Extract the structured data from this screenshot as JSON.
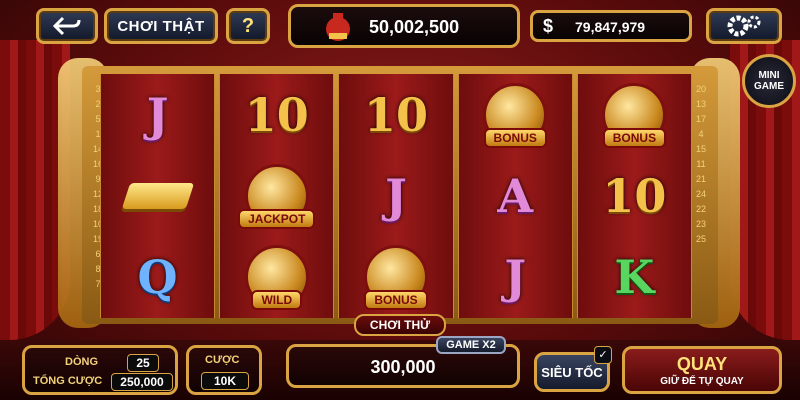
{
  "top": {
    "back_icon": "arrow-back-icon",
    "play_real_label": "CHƠI THẬT",
    "help_label": "?",
    "jackpot_value": "50,002,500",
    "balance_currency": "$",
    "balance_value": "79,847,979",
    "settings_icon": "gear-icon"
  },
  "mini_game": {
    "line1": "MINI",
    "line2": "GAME"
  },
  "line_numbers": {
    "left": [
      "3",
      "2",
      "5",
      "1",
      "14",
      "16",
      "9",
      "12",
      "18",
      "10",
      "19",
      "6",
      "8",
      "7"
    ],
    "right": [
      "20",
      "13",
      "17",
      "4",
      "15",
      "11",
      "21",
      "24",
      "22",
      "23",
      "25"
    ]
  },
  "reels": [
    [
      {
        "kind": "letter",
        "value": "J",
        "color": "pink"
      },
      {
        "kind": "gold",
        "value": ""
      },
      {
        "kind": "letter",
        "value": "Q",
        "color": "blue"
      }
    ],
    [
      {
        "kind": "letter",
        "value": "10",
        "color": "gold"
      },
      {
        "kind": "badge",
        "value": "JACKPOT"
      },
      {
        "kind": "badge",
        "value": "WILD"
      }
    ],
    [
      {
        "kind": "letter",
        "value": "10",
        "color": "gold"
      },
      {
        "kind": "letter",
        "value": "J",
        "color": "pink"
      },
      {
        "kind": "badge",
        "value": "BONUS"
      }
    ],
    [
      {
        "kind": "badge",
        "value": "BONUS"
      },
      {
        "kind": "letter",
        "value": "A",
        "color": "pink"
      },
      {
        "kind": "letter",
        "value": "J",
        "color": "pink"
      }
    ],
    [
      {
        "kind": "badge",
        "value": "BONUS"
      },
      {
        "kind": "letter",
        "value": "10",
        "color": "gold"
      },
      {
        "kind": "letter",
        "value": "K",
        "color": "green"
      }
    ]
  ],
  "try_label": "CHƠI THỬ",
  "bottom": {
    "lines_label": "DÒNG",
    "lines_value": "25",
    "total_bet_label": "TỔNG CƯỢC",
    "total_bet_value": "250,000",
    "bet_label": "CƯỢC",
    "bet_value": "10K",
    "win_value": "300,000",
    "game_x2_label": "GAME X2",
    "turbo_label": "SIÊU TỐC",
    "turbo_check": "✓",
    "spin_label": "QUAY",
    "auto_spin_label": "GIỮ ĐỂ TỰ QUAY"
  },
  "colors": {
    "gold": "#d9a441",
    "red": "#8e1d1d"
  }
}
